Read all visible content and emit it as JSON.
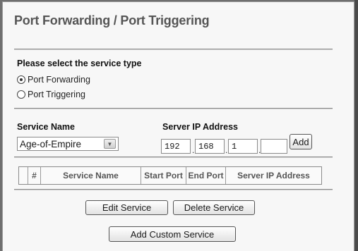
{
  "page": {
    "title": "Port Forwarding / Port Triggering"
  },
  "service_type": {
    "label": "Please select the service type",
    "options": [
      {
        "label": "Port Forwarding",
        "selected": true
      },
      {
        "label": "Port Triggering",
        "selected": false
      }
    ]
  },
  "service_name": {
    "label": "Service Name",
    "selected_value": "Age-of-Empire"
  },
  "server_ip": {
    "label": "Server IP Address",
    "octets": [
      "192",
      "168",
      "1",
      ""
    ],
    "add_label": "Add"
  },
  "table": {
    "headers": [
      "",
      "#",
      "Service Name",
      "Start Port",
      "End Port",
      "Server IP Address"
    ]
  },
  "actions": {
    "edit_label": "Edit Service",
    "delete_label": "Delete Service",
    "add_custom_label": "Add Custom Service"
  }
}
